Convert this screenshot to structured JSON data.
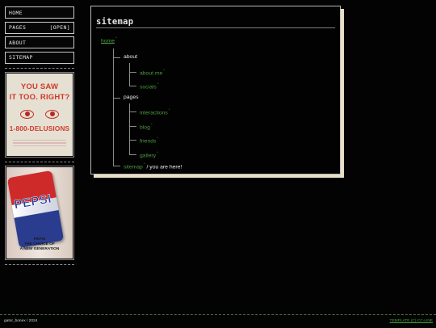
{
  "nav": {
    "items": [
      {
        "label": "HOME",
        "badge": ""
      },
      {
        "label": "PAGES",
        "badge": "[OPEN]"
      },
      {
        "label": "ABOUT",
        "badge": ""
      },
      {
        "label": "SITEMAP",
        "badge": ""
      }
    ]
  },
  "ads": {
    "poster": {
      "line1": "YOU SAW",
      "line2": "IT TOO. RIGHT?",
      "phone": "1-800-DELUSIONS"
    },
    "pepsi": {
      "logo": "PEPSI",
      "tagline1": "PEPSI",
      "tagline2": "THE CHOICE OF",
      "tagline3": "A NEW GENERATION"
    }
  },
  "main": {
    "title": "sitemap",
    "tree": {
      "home": "home",
      "about": "about",
      "about_me": "about me",
      "socials": "socials",
      "pages": "pages",
      "interactions": "interactions",
      "blog": "blog",
      "friends": "friends",
      "gallery": "gallery",
      "sitemap": "sitemap",
      "here": "/ you are here!",
      "link_mark": "°"
    }
  },
  "footer": {
    "left": "gator_bonex / 2024",
    "right": "TEMPLATE (C) CC-LINE"
  },
  "colors": {
    "background": "#030303",
    "link_green": "#4a9e3e",
    "panel_shadow": "#e7e0c6",
    "poster_red": "#cf3a2a"
  }
}
